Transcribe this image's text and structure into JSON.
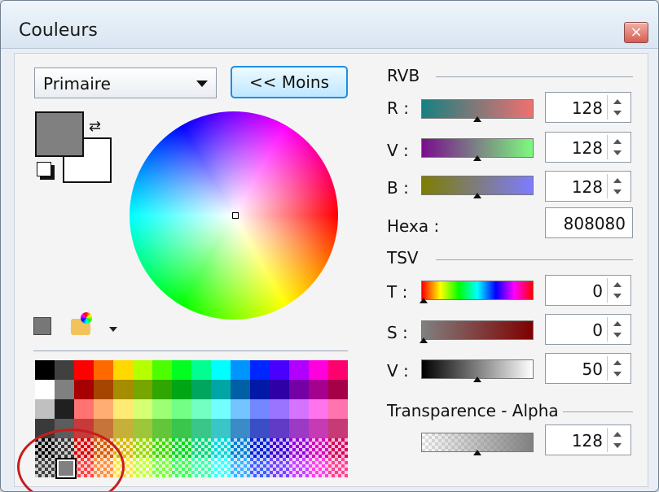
{
  "window": {
    "title": "Couleurs",
    "close_label": "×"
  },
  "left": {
    "mode_select": {
      "selected": "Primaire"
    },
    "toggle_button": {
      "label": "<< Moins"
    }
  },
  "rvb": {
    "heading": "RVB",
    "r": {
      "label": "R :",
      "value": "128"
    },
    "g": {
      "label": "V :",
      "value": "128"
    },
    "b": {
      "label": "B :",
      "value": "128"
    },
    "hex": {
      "label": "Hexa :",
      "value": "808080"
    }
  },
  "tsv": {
    "heading": "TSV",
    "h": {
      "label": "T :",
      "value": "0"
    },
    "s": {
      "label": "S :",
      "value": "0"
    },
    "v": {
      "label": "V :",
      "value": "50"
    }
  },
  "alpha": {
    "heading": "Transparence - Alpha",
    "value": "128"
  },
  "colors": {
    "accent": "#1e8fe2",
    "selection_highlight": "#c71c1c"
  },
  "icons": {
    "swap": "swap-colors-icon",
    "reset": "reset-colors-icon",
    "add_color": "add-color-icon",
    "palette": "palette-folder-icon",
    "close": "close-icon"
  }
}
